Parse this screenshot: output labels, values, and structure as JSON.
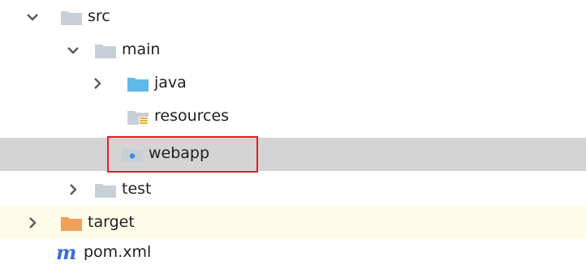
{
  "tree": {
    "src": {
      "label": "src",
      "icon": "folder-icon",
      "state": "expanded"
    },
    "main": {
      "label": "main",
      "icon": "folder-icon",
      "state": "expanded"
    },
    "java": {
      "label": "java",
      "icon": "source-folder-icon",
      "state": "collapsed"
    },
    "resources": {
      "label": "resources",
      "icon": "resources-folder-icon"
    },
    "webapp": {
      "label": "webapp",
      "icon": "web-folder-icon",
      "selected": true
    },
    "test": {
      "label": "test",
      "icon": "folder-icon",
      "state": "collapsed"
    },
    "target": {
      "label": "target",
      "icon": "excluded-folder-icon",
      "state": "collapsed"
    },
    "pom": {
      "label": "pom.xml",
      "icon": "maven-icon"
    }
  },
  "colors": {
    "folder": "#c8cfd6",
    "source_folder": "#5fb8e8",
    "excluded_folder": "#f0a05a",
    "selection": "#d4d4d4",
    "excluded_row": "#fefce8",
    "highlight_border": "#e0202a",
    "maven_m": "#3f6bd6"
  }
}
